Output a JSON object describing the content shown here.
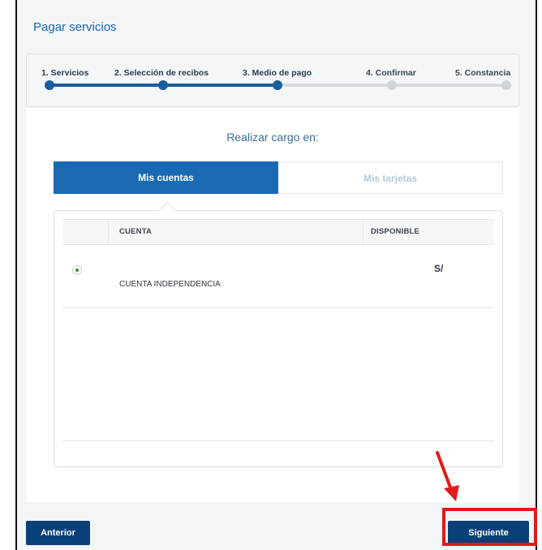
{
  "page": {
    "title": "Pagar servicios"
  },
  "stepper": {
    "steps": [
      {
        "label": "1. Servicios",
        "state": "done"
      },
      {
        "label": "2. Selección de recibos",
        "state": "done"
      },
      {
        "label": "3. Medio de pago",
        "state": "current"
      },
      {
        "label": "4. Confirmar",
        "state": "todo"
      },
      {
        "label": "5. Constancia",
        "state": "todo"
      }
    ]
  },
  "payment": {
    "subtitle": "Realizar cargo en:",
    "tabs": [
      {
        "label": "Mis cuentas",
        "active": true
      },
      {
        "label": "Mis tarjetas",
        "active": false
      }
    ],
    "table": {
      "headers": [
        "CUENTA",
        "DISPONIBLE"
      ],
      "rows": [
        {
          "selected": true,
          "account": "CUENTA INDEPENDENCIA",
          "available": "S/"
        }
      ]
    }
  },
  "actions": {
    "prev_label": "Anterior",
    "next_label": "Siguiente"
  },
  "colors": {
    "primary": "#1a6ab3",
    "button": "#0b3f77",
    "annotation": "#e01b1b",
    "radio_selected": "#3d8c2f"
  }
}
